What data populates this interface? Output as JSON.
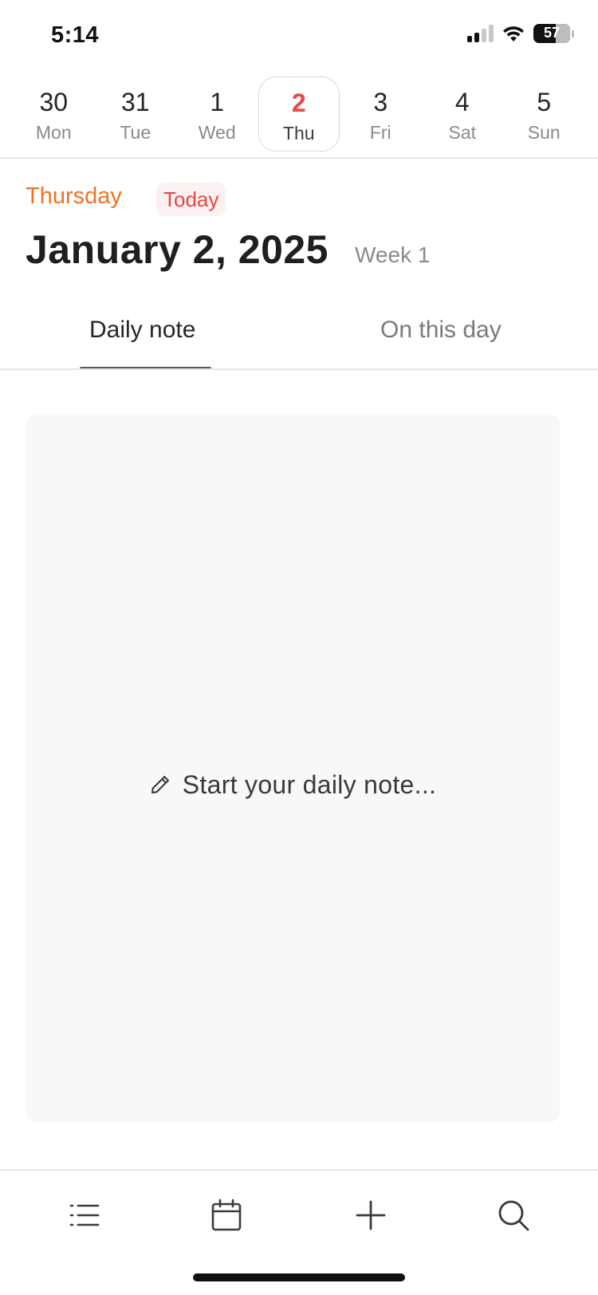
{
  "status_bar": {
    "time": "5:14",
    "battery": "57"
  },
  "week_strip": {
    "days": [
      {
        "num": "30",
        "name": "Mon"
      },
      {
        "num": "31",
        "name": "Tue"
      },
      {
        "num": "1",
        "name": "Wed"
      },
      {
        "num": "2",
        "name": "Thu"
      },
      {
        "num": "3",
        "name": "Fri"
      },
      {
        "num": "4",
        "name": "Sat"
      },
      {
        "num": "5",
        "name": "Sun"
      }
    ],
    "selected_index": 3
  },
  "header": {
    "weekday": "Thursday",
    "today_badge": "Today",
    "title": "January 2, 2025",
    "week": "Week 1"
  },
  "tabs": [
    {
      "label": "Daily note",
      "active": true
    },
    {
      "label": "On this day",
      "active": false
    }
  ],
  "note": {
    "placeholder": "Start your daily note..."
  },
  "bottom_bar": {
    "items": [
      {
        "icon": "list-icon"
      },
      {
        "icon": "calendar-icon"
      },
      {
        "icon": "plus-icon"
      },
      {
        "icon": "search-icon"
      }
    ]
  },
  "colors": {
    "accent_orange": "#f07222",
    "accent_red": "#e34848",
    "badge_bg": "#fdf0f0",
    "card_bg": "#f9f8f6"
  }
}
